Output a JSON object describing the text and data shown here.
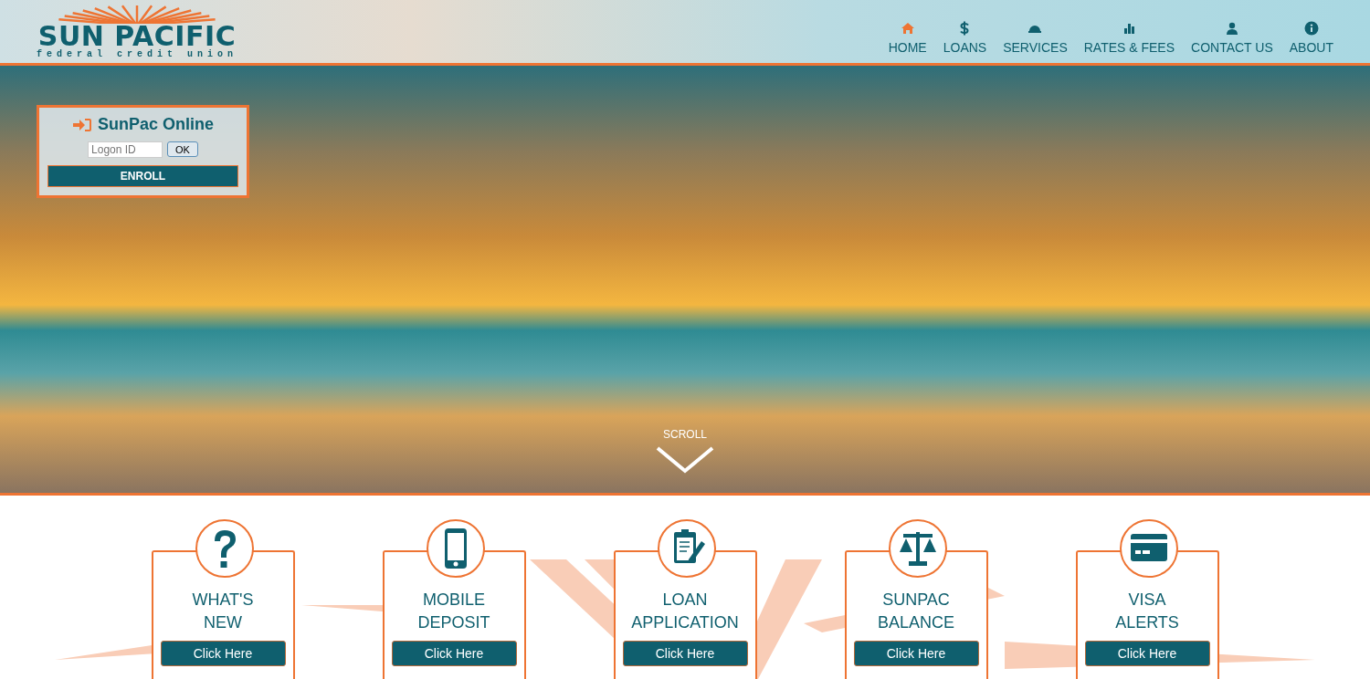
{
  "header": {
    "logo": {
      "name": "SUN PACIFIC",
      "tagline": "federal credit union"
    },
    "nav": [
      {
        "label": "HOME",
        "kind": "home",
        "selected": true
      },
      {
        "label": "LOANS",
        "kind": "loans",
        "selected": false
      },
      {
        "label": "SERVICES",
        "kind": "services",
        "selected": false
      },
      {
        "label": "RATES & FEES",
        "kind": "rates",
        "selected": false
      },
      {
        "label": "CONTACT US",
        "kind": "contact",
        "selected": false
      },
      {
        "label": "ABOUT",
        "kind": "about",
        "selected": false
      }
    ]
  },
  "login": {
    "title": "SunPac Online",
    "placeholder": "Logon ID",
    "ok": "OK",
    "enroll": "ENROLL"
  },
  "hero": {
    "scroll": "SCROLL"
  },
  "cards": [
    {
      "kind": "news",
      "title": [
        "WHAT'S",
        "NEW"
      ],
      "button": "Click Here"
    },
    {
      "kind": "deposit",
      "title": [
        "MOBILE",
        "DEPOSIT"
      ],
      "button": "Click Here"
    },
    {
      "kind": "loan",
      "title": [
        "LOAN",
        "APPLICATION"
      ],
      "button": "Click Here"
    },
    {
      "kind": "balance",
      "title": [
        "SUNPAC",
        "BALANCE"
      ],
      "button": "Click Here"
    },
    {
      "kind": "visa",
      "title": [
        "VISA",
        "ALERTS"
      ],
      "button": "Click Here"
    }
  ]
}
